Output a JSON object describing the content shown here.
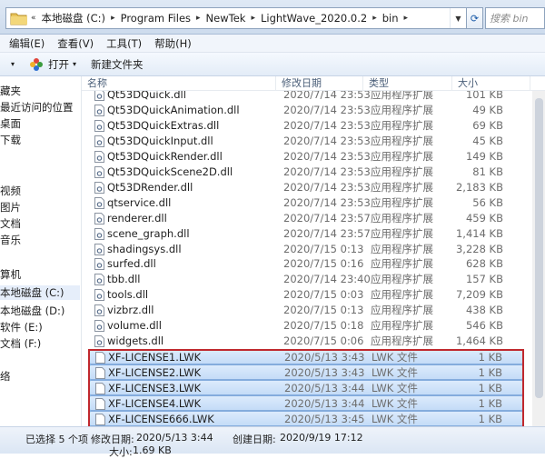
{
  "address": {
    "crumbs": [
      "本地磁盘 (C:)",
      "Program Files",
      "NewTek",
      "LightWave_2020.0.2",
      "bin"
    ],
    "search_placeholder": "搜索 bin"
  },
  "menu": [
    "编辑(E)",
    "查看(V)",
    "工具(T)",
    "帮助(H)"
  ],
  "toolbar": {
    "open_label": "打开",
    "new_folder_label": "新建文件夹"
  },
  "nav": [
    "藏夹",
    "最近访问的位置",
    "桌面",
    "下载",
    "",
    "视频",
    "图片",
    "文档",
    "音乐",
    "",
    "算机",
    "本地磁盘 (C:)",
    "本地磁盘 (D:)",
    "软件 (E:)",
    "文档 (F:)",
    "",
    "络"
  ],
  "columns": {
    "name": "名称",
    "date": "修改日期",
    "type": "类型",
    "size": "大小"
  },
  "files": [
    {
      "name": "Qt53DQuick.dll",
      "date": "2020/7/14 23:53",
      "type": "应用程序扩展",
      "size": "101 KB",
      "sel": false
    },
    {
      "name": "Qt53DQuickAnimation.dll",
      "date": "2020/7/14 23:53",
      "type": "应用程序扩展",
      "size": "49 KB",
      "sel": false
    },
    {
      "name": "Qt53DQuickExtras.dll",
      "date": "2020/7/14 23:53",
      "type": "应用程序扩展",
      "size": "69 KB",
      "sel": false
    },
    {
      "name": "Qt53DQuickInput.dll",
      "date": "2020/7/14 23:53",
      "type": "应用程序扩展",
      "size": "45 KB",
      "sel": false
    },
    {
      "name": "Qt53DQuickRender.dll",
      "date": "2020/7/14 23:53",
      "type": "应用程序扩展",
      "size": "149 KB",
      "sel": false
    },
    {
      "name": "Qt53DQuickScene2D.dll",
      "date": "2020/7/14 23:53",
      "type": "应用程序扩展",
      "size": "81 KB",
      "sel": false
    },
    {
      "name": "Qt53DRender.dll",
      "date": "2020/7/14 23:53",
      "type": "应用程序扩展",
      "size": "2,183 KB",
      "sel": false
    },
    {
      "name": "qtservice.dll",
      "date": "2020/7/14 23:53",
      "type": "应用程序扩展",
      "size": "56 KB",
      "sel": false
    },
    {
      "name": "renderer.dll",
      "date": "2020/7/14 23:57",
      "type": "应用程序扩展",
      "size": "459 KB",
      "sel": false
    },
    {
      "name": "scene_graph.dll",
      "date": "2020/7/14 23:57",
      "type": "应用程序扩展",
      "size": "1,414 KB",
      "sel": false
    },
    {
      "name": "shadingsys.dll",
      "date": "2020/7/15 0:13",
      "type": "应用程序扩展",
      "size": "3,228 KB",
      "sel": false
    },
    {
      "name": "surfed.dll",
      "date": "2020/7/15 0:16",
      "type": "应用程序扩展",
      "size": "628 KB",
      "sel": false
    },
    {
      "name": "tbb.dll",
      "date": "2020/7/14 23:40",
      "type": "应用程序扩展",
      "size": "157 KB",
      "sel": false
    },
    {
      "name": "tools.dll",
      "date": "2020/7/15 0:03",
      "type": "应用程序扩展",
      "size": "7,209 KB",
      "sel": false
    },
    {
      "name": "vizbrz.dll",
      "date": "2020/7/15 0:13",
      "type": "应用程序扩展",
      "size": "438 KB",
      "sel": false
    },
    {
      "name": "volume.dll",
      "date": "2020/7/15 0:18",
      "type": "应用程序扩展",
      "size": "546 KB",
      "sel": false
    },
    {
      "name": "widgets.dll",
      "date": "2020/7/15 0:06",
      "type": "应用程序扩展",
      "size": "1,464 KB",
      "sel": false
    },
    {
      "name": "XF-LICENSE1.LWK",
      "date": "2020/5/13 3:43",
      "type": "LWK 文件",
      "size": "1 KB",
      "sel": true
    },
    {
      "name": "XF-LICENSE2.LWK",
      "date": "2020/5/13 3:43",
      "type": "LWK 文件",
      "size": "1 KB",
      "sel": true
    },
    {
      "name": "XF-LICENSE3.LWK",
      "date": "2020/5/13 3:44",
      "type": "LWK 文件",
      "size": "1 KB",
      "sel": true
    },
    {
      "name": "XF-LICENSE4.LWK",
      "date": "2020/5/13 3:44",
      "type": "LWK 文件",
      "size": "1 KB",
      "sel": true
    },
    {
      "name": "XF-LICENSE666.LWK",
      "date": "2020/5/13 3:45",
      "type": "LWK 文件",
      "size": "1 KB",
      "sel": true
    }
  ],
  "status": {
    "selected": "已选择 5 个项",
    "modified_label": "修改日期:",
    "modified_value": "2020/5/13 3:44",
    "created_label": "创建日期:",
    "created_value": "2020/9/19 17:12",
    "size_label": "大小:",
    "size_value": "1.69 KB"
  },
  "colors": {
    "highlight_border": "#c0282d",
    "selection": "#c4dcf7"
  }
}
